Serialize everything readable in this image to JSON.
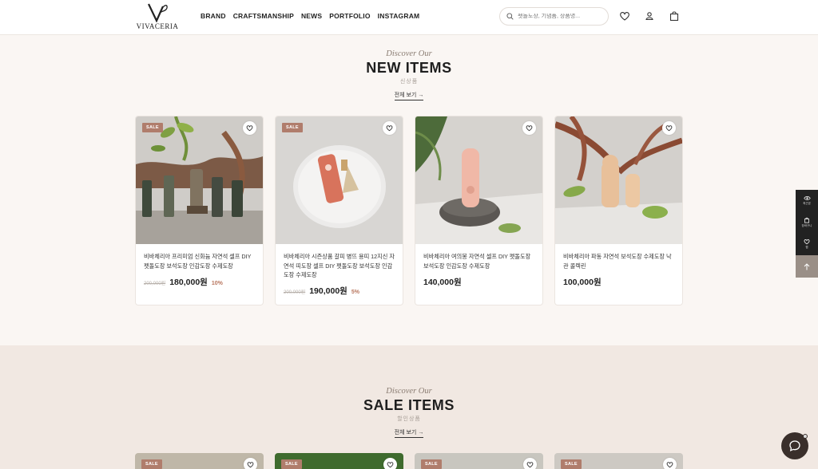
{
  "header": {
    "logo_text": "VIVACERIA",
    "nav": [
      "BRAND",
      "CRAFTSMANSHIP",
      "NEWS",
      "PORTFOLIO",
      "INSTAGRAM"
    ],
    "search_placeholder": "펫돌도장, 기념품, 상품명..."
  },
  "new_items": {
    "discover": "Discover Our",
    "title": "NEW ITEMS",
    "subtitle": "신상품",
    "view_all": "전체 보기 →"
  },
  "sale_items": {
    "discover": "Discover Our",
    "title": "SALE ITEMS",
    "subtitle": "할인상품",
    "view_all": "전체 보기 →"
  },
  "products": [
    {
      "badge": "SALE",
      "name": "비바체리아 프리미엄 신화늄 자연석 셀프 DIY 펫돌도장 보석도장 인감도장 수제도장",
      "old_price": "200,000원",
      "price": "180,000원",
      "discount": "10%"
    },
    {
      "badge": "SALE",
      "name": "비바체리아 시즌상품 갈피 병뜨 용띠 12지신 자연석 띠도장 셀프 DIY 펫돌도장 보석도장 인감도장 수제도장",
      "old_price": "200,000원",
      "price": "190,000원",
      "discount": "5%"
    },
    {
      "name": "비바체리아 여의봉 자연석 셀프 DIY 펫돌도장 보석도장 인감도장 수제도장",
      "price": "140,000원"
    },
    {
      "name": "비바체리아 파동 자연석 보석도장 수제도장 낙관 콜렉린",
      "price": "100,000원"
    }
  ],
  "sale_badge": "SALE",
  "side_widget": [
    "최근본",
    "장바구니",
    "찜"
  ]
}
